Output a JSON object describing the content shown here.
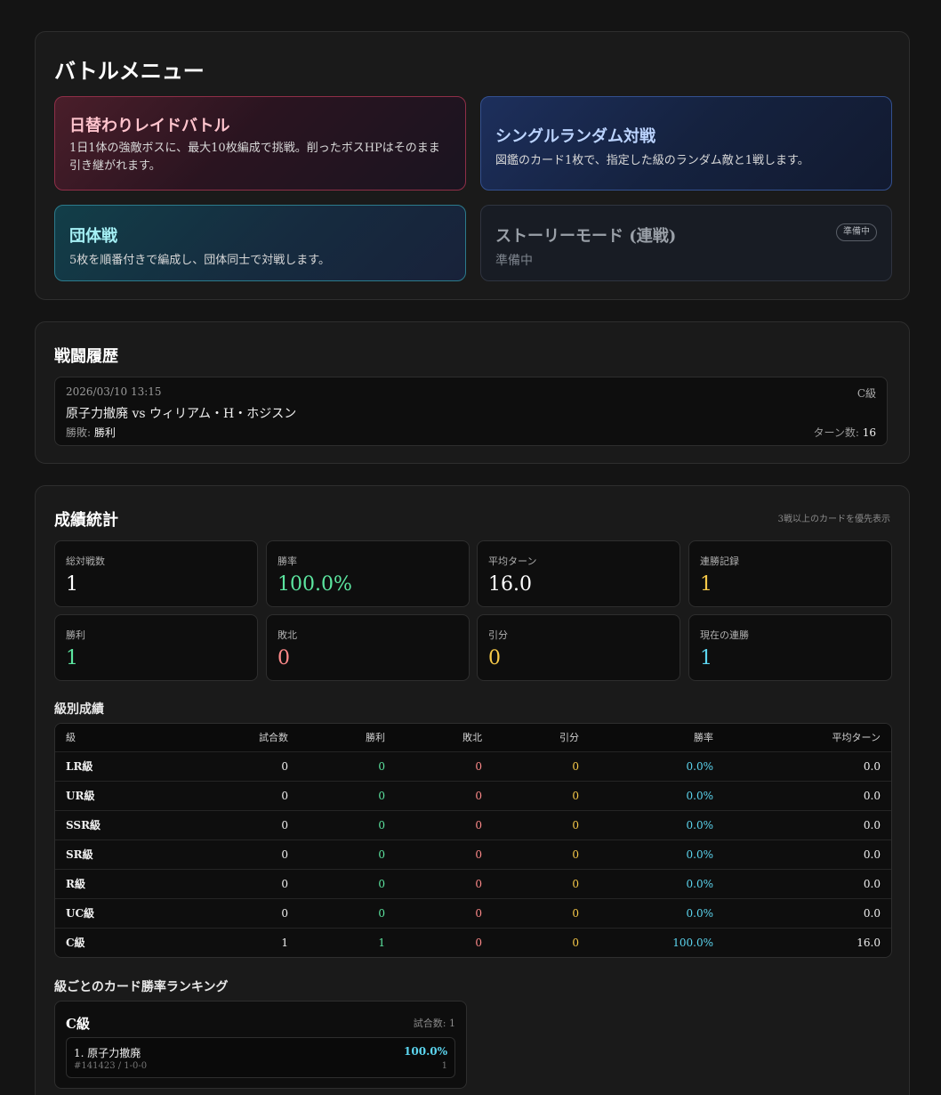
{
  "battle_menu": {
    "title": "バトルメニュー",
    "raid": {
      "title": "日替わりレイドバトル",
      "desc": "1日1体の強敵ボスに、最大10枚編成で挑戦。削ったボスHPはそのまま引き継がれます。"
    },
    "single": {
      "title": "シングルランダム対戦",
      "desc": "図鑑のカード1枚で、指定した級のランダム敵と1戦します。"
    },
    "team": {
      "title": "団体戦",
      "desc": "5枚を順番付きで編成し、団体同士で対戦します。"
    },
    "story": {
      "title": "ストーリーモード (連戦)",
      "desc": "準備中",
      "badge": "準備中"
    }
  },
  "history": {
    "title": "戦闘履歴",
    "items": [
      {
        "timestamp": "2026/03/10 13:15",
        "grade": "C級",
        "match": "原子力撤廃 vs ウィリアム・H・ホジスン",
        "result_label": "勝敗: ",
        "result": "勝利",
        "turns_label": "ターン数: ",
        "turns": "16"
      }
    ]
  },
  "stats": {
    "title": "成績統計",
    "hint": "3戦以上のカードを優先表示",
    "boxes": [
      {
        "label": "総対戦数",
        "value": "1"
      },
      {
        "label": "勝率",
        "value": "100.0%"
      },
      {
        "label": "平均ターン",
        "value": "16.0"
      },
      {
        "label": "連勝記録",
        "value": "1"
      },
      {
        "label": "勝利",
        "value": "1"
      },
      {
        "label": "敗北",
        "value": "0"
      },
      {
        "label": "引分",
        "value": "0"
      },
      {
        "label": "現在の連勝",
        "value": "1"
      }
    ],
    "grade_section_title": "級別成績",
    "grade_table": {
      "headers": [
        "級",
        "試合数",
        "勝利",
        "敗北",
        "引分",
        "勝率",
        "平均ターン"
      ],
      "rows": [
        [
          "LR級",
          "0",
          "0",
          "0",
          "0",
          "0.0%",
          "0.0"
        ],
        [
          "UR級",
          "0",
          "0",
          "0",
          "0",
          "0.0%",
          "0.0"
        ],
        [
          "SSR級",
          "0",
          "0",
          "0",
          "0",
          "0.0%",
          "0.0"
        ],
        [
          "SR級",
          "0",
          "0",
          "0",
          "0",
          "0.0%",
          "0.0"
        ],
        [
          "R級",
          "0",
          "0",
          "0",
          "0",
          "0.0%",
          "0.0"
        ],
        [
          "UC級",
          "0",
          "0",
          "0",
          "0",
          "0.0%",
          "0.0"
        ],
        [
          "C級",
          "1",
          "1",
          "0",
          "0",
          "100.0%",
          "16.0"
        ]
      ]
    },
    "ranking_section_title": "級ごとのカード勝率ランキング",
    "ranking": {
      "grade": "C級",
      "count_label": "試合数: 1",
      "entries": [
        {
          "name": "1. 原子力撤廃",
          "rate": "100.0%",
          "meta": "#141423 / 1-0-0",
          "games": "1"
        }
      ]
    }
  },
  "colors": {
    "win": "#5ce6a0",
    "loss": "#ff8a8a",
    "draw": "#f7c948",
    "rate": "#5cd6f0"
  }
}
